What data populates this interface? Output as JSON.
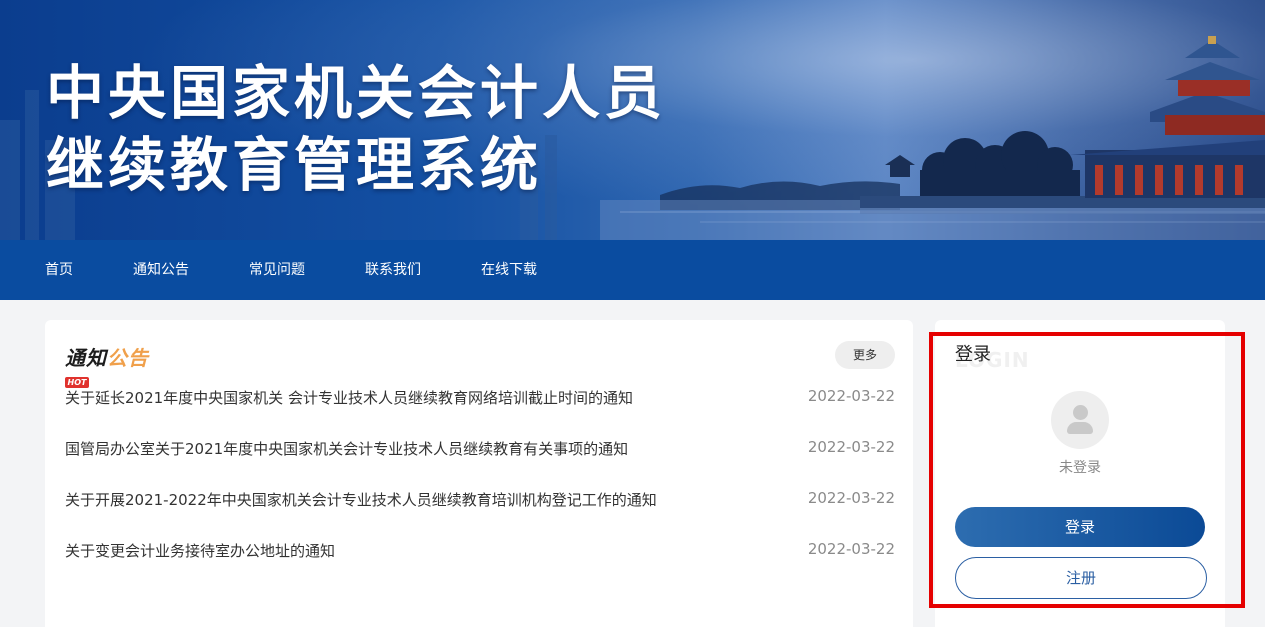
{
  "banner": {
    "title_line1": "中央国家机关会计人员",
    "title_line2": "继续教育管理系统"
  },
  "nav": {
    "items": [
      {
        "label": "首页"
      },
      {
        "label": "通知公告"
      },
      {
        "label": "常见问题"
      },
      {
        "label": "联系我们"
      },
      {
        "label": "在线下载"
      }
    ]
  },
  "notice": {
    "title_part1": "通知",
    "title_part2": "公告",
    "hot_badge": "HOT",
    "more_label": "更多",
    "items": [
      {
        "title": "关于延长2021年度中央国家机关 会计专业技术人员继续教育网络培训截止时间的通知",
        "date": "2022-03-22"
      },
      {
        "title": "国管局办公室关于2021年度中央国家机关会计专业技术人员继续教育有关事项的通知",
        "date": "2022-03-22"
      },
      {
        "title": "关于开展2021-2022年中央国家机关会计专业技术人员继续教育培训机构登记工作的通知",
        "date": "2022-03-22"
      },
      {
        "title": "关于变更会计业务接待室办公地址的通知",
        "date": "2022-03-22"
      }
    ]
  },
  "login": {
    "title": "登录",
    "watermark": "LOGIN",
    "status": "未登录",
    "login_button": "登录",
    "register_button": "注册"
  },
  "colors": {
    "nav_bg": "#0a4ca0",
    "accent_orange": "#f0a04b",
    "highlight_red": "#e50000"
  }
}
